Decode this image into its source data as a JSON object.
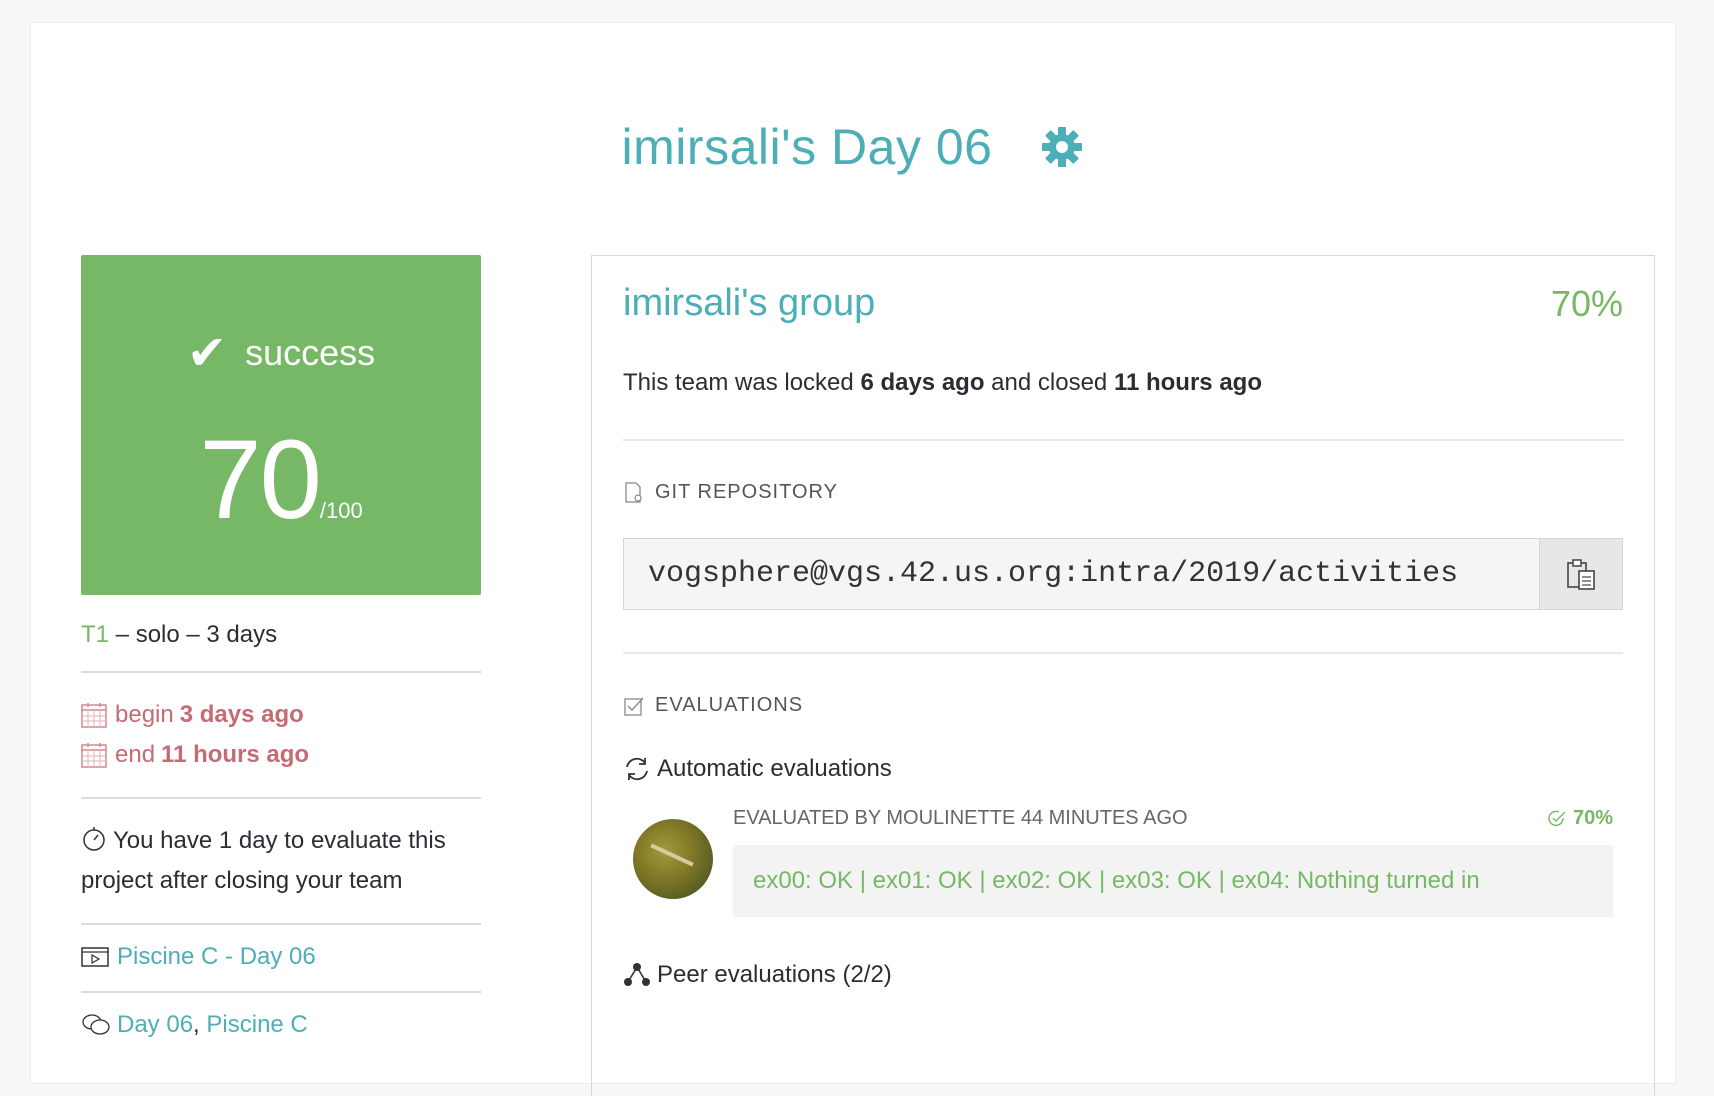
{
  "page": {
    "title": "imirsali's Day 06",
    "settings_icon": "gear-icon"
  },
  "score": {
    "status": "success",
    "value": "70",
    "max": "/100",
    "color": "#76b865"
  },
  "team_info": {
    "tier": "T1",
    "details": " – solo – 3 days"
  },
  "dates": {
    "begin_label": "begin",
    "begin_value": "3 days ago",
    "end_label": "end",
    "end_value": "11 hours ago"
  },
  "evaluation_notice": "You have 1 day to evaluate this project after closing your team",
  "links": {
    "project": "Piscine C - Day 06",
    "tag_1": "Day 06",
    "separator": ",",
    "tag_2": "Piscine C"
  },
  "group": {
    "name": "imirsali's group",
    "percent": "70%",
    "locked_prefix": "This team was locked",
    "locked_when": "6 days ago",
    "closed_prefix": "and closed",
    "closed_when": "11 hours ago"
  },
  "git": {
    "section_title": "GIT REPOSITORY",
    "repo_url": "vogsphere@vgs.42.us.org:intra/2019/activities"
  },
  "evaluations": {
    "section_title": "EVALUATIONS",
    "automatic_title": "Automatic evaluations",
    "auto_eval": {
      "evaluator": "EVALUATED BY MOULINETTE 44 MINUTES AGO",
      "percent": "70%",
      "result": "ex00: OK | ex01: OK | ex02: OK | ex03: OK | ex04: Nothing turned in"
    },
    "peer_title": "Peer evaluations (2/2)"
  },
  "colors": {
    "accent": "#4cafb7",
    "success": "#76b865",
    "date_red": "#c66b73"
  }
}
